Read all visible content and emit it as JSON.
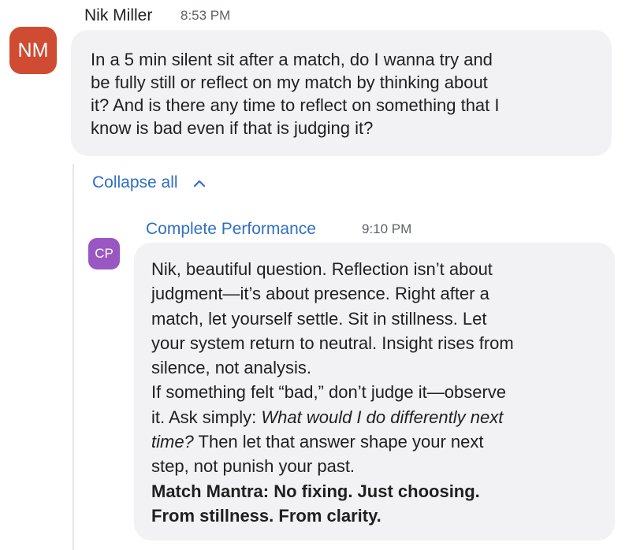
{
  "message1": {
    "avatar": "NM",
    "sender": "Nik Miller",
    "time": "8:53 PM",
    "lines": [
      "In a 5 min silent sit after a match, do I wanna try and",
      "be fully still or reflect on my match by thinking about",
      "it? And is there any time to reflect on something that I",
      "know is bad even if that is judging it?"
    ]
  },
  "thread": {
    "collapse_label": "Collapse all",
    "collapse_icon": "chevron-up-icon"
  },
  "message2": {
    "avatar": "CP",
    "sender": "Complete Performance",
    "time": "9:10 PM",
    "lines": [
      "Nik, beautiful question. Reflection isn’t about",
      "judgment—it’s about presence. Right after a",
      "match, let yourself settle. Sit in stillness. Let",
      "your system return to neutral. Insight rises from",
      "silence, not analysis.",
      "If something felt “bad,” don’t judge it—observe",
      "it. Ask simply:",
      "What would I do differently next",
      "time?",
      "Then let that answer shape your next",
      "step, not punish your past.",
      "Match Mantra: No fixing. Just choosing.",
      "From stillness. From clarity."
    ]
  },
  "colors": {
    "nm_avatar": "#cf4b31",
    "cp_avatar": "#9a56c1",
    "link_blue": "#2f6fc4",
    "bubble_bg": "#f2f2f5"
  }
}
